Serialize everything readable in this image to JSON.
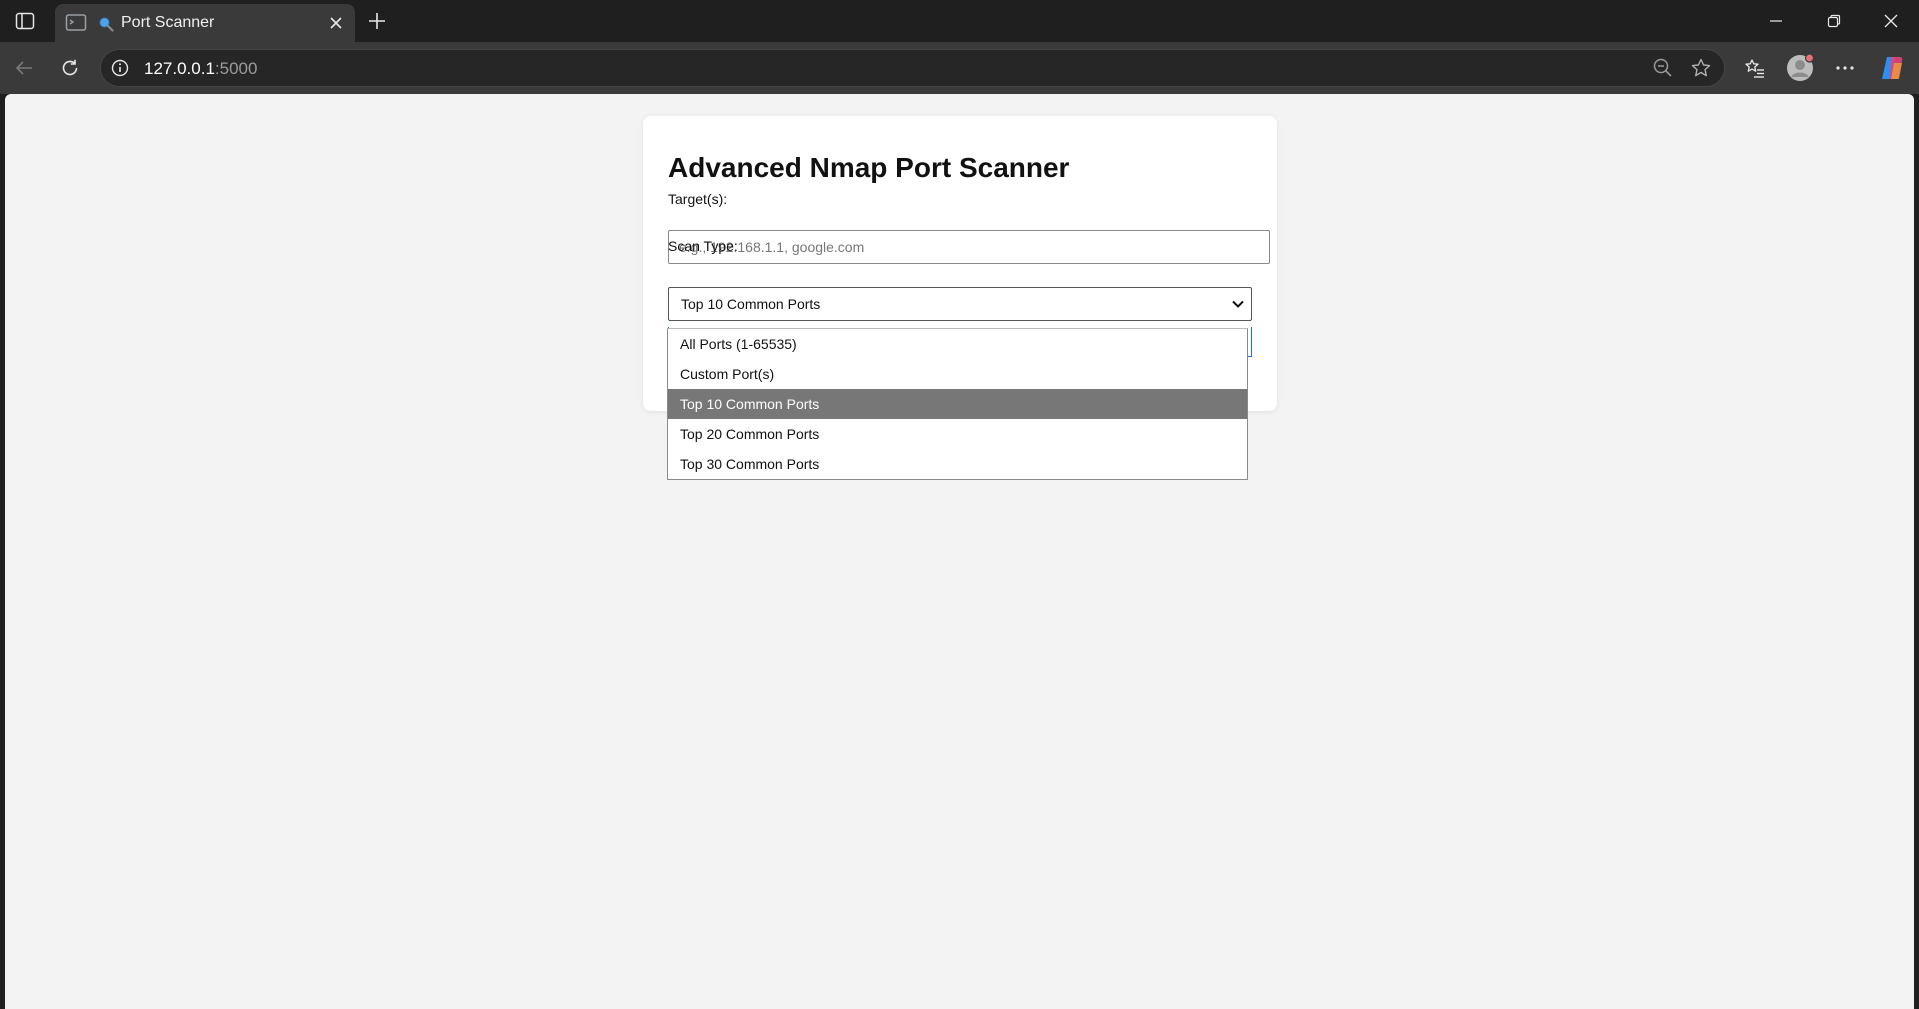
{
  "browser": {
    "tab": {
      "title": "Port Scanner",
      "favicon": "magnifier-icon"
    },
    "url": {
      "host": "127.0.0.1",
      "port": ":5000"
    }
  },
  "page": {
    "title": "Advanced Nmap Port Scanner",
    "target_label": "Target(s):",
    "target_placeholder": "e.g., 192.168.1.1, google.com",
    "target_value": "",
    "scan_type_label": "Scan Type:",
    "scan_type_selected": "Top 10 Common Ports",
    "scan_type_options": [
      "All Ports (1-65535)",
      "Custom Port(s)",
      "Top 10 Common Ports",
      "Top 20 Common Ports",
      "Top 30 Common Ports"
    ]
  },
  "colors": {
    "accent": "#1a73e8",
    "selected_option_bg": "#777777",
    "page_bg": "#f3f3f3"
  }
}
